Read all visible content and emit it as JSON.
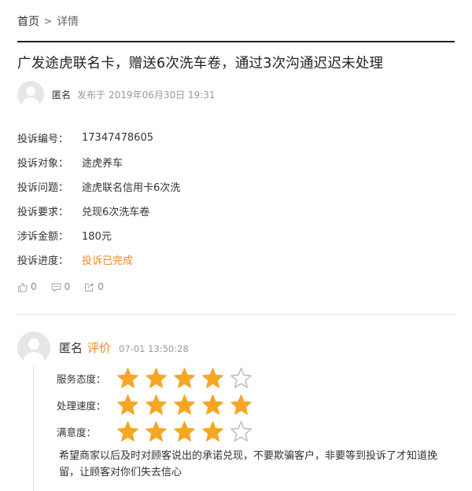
{
  "breadcrumb": {
    "home": "首页",
    "separator": ">",
    "current": "详情"
  },
  "title": "广发途虎联名卡，赠送6次洗车卷，通过3次沟通迟迟未处理",
  "author": {
    "name": "匿名",
    "publish_prefix": "发布于",
    "publish_time": "2019年06月30日 19:31"
  },
  "info": {
    "rows": [
      {
        "key": "投诉编号：",
        "value": "17347478605"
      },
      {
        "key": "投诉对象：",
        "value": "途虎养车"
      },
      {
        "key": "投诉问题：",
        "value": "途虎联名信用卡6次洗"
      },
      {
        "key": "投诉要求：",
        "value": "兑现6次洗车卷"
      },
      {
        "key": "涉诉金额：",
        "value": "180元"
      },
      {
        "key": "投诉进度：",
        "value": "投诉已完成"
      }
    ]
  },
  "actions": {
    "like_count": "0",
    "comment_count": "0",
    "share_count": "0"
  },
  "review": {
    "name": "匿名",
    "tag": "评价",
    "time": "07-01 13:50:28",
    "ratings": [
      {
        "label": "服务态度：",
        "stars": 4,
        "max": 5
      },
      {
        "label": "处理速度：",
        "stars": 5,
        "max": 5
      },
      {
        "label": "满意度：",
        "stars": 4,
        "max": 5
      }
    ],
    "text": "希望商家以后及时对顾客说出的承诺兑现，不要欺骗客户，非要等到投诉了才知道挽留，让顾客对你们失去信心"
  },
  "colors": {
    "accent": "#f08a24",
    "star": "#f5a623",
    "star_empty": "#bbbbbb"
  },
  "icons": {
    "like": "thumbs-up-icon",
    "comment": "comment-icon",
    "share": "share-icon",
    "avatar": "user-avatar-icon"
  }
}
